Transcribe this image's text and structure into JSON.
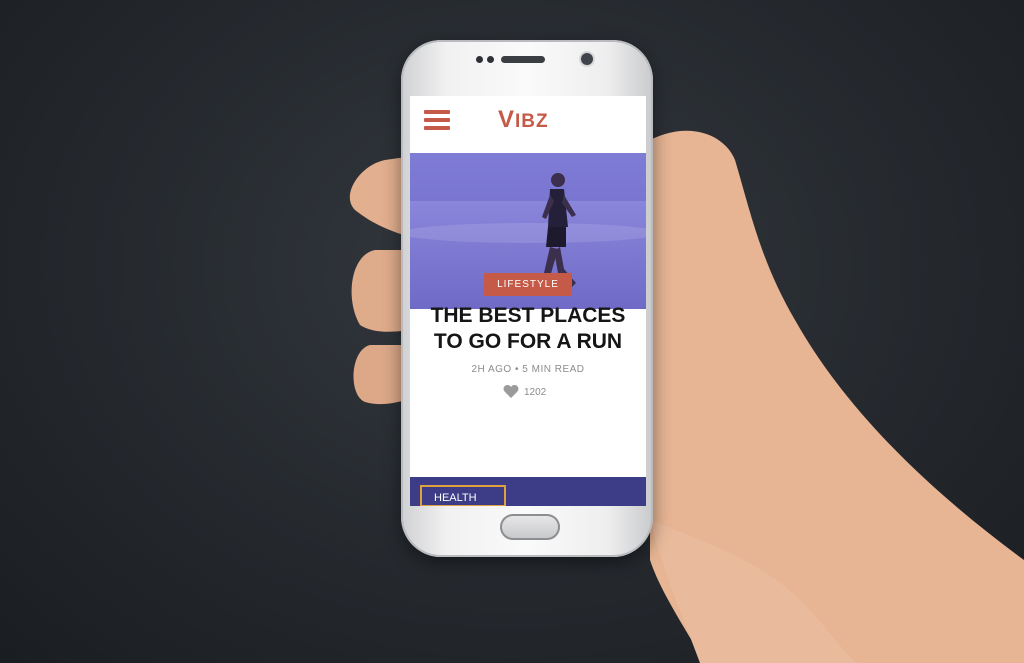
{
  "app": {
    "logo_text": "VIBZ",
    "logo_first": "V",
    "logo_rest": "IBZ",
    "accent_color": "#c45a47"
  },
  "menu_icon": "hamburger-menu-icon",
  "article": {
    "category": "LIFESTYLE",
    "title": "THE BEST PLACES TO GO FOR A RUN",
    "time_ago": "2H AGO",
    "read_time": "5 MIN READ",
    "likes": "1202",
    "like_icon": "heart-icon"
  },
  "next_article": {
    "category": "HEALTH"
  }
}
